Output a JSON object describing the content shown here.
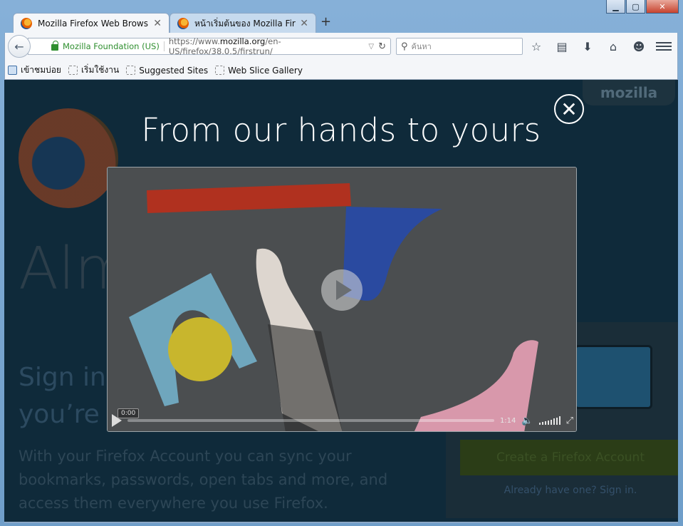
{
  "window": {
    "minimize": "▁",
    "maximize": "▢",
    "close": "✕"
  },
  "tabs": [
    {
      "label": "Mozilla Firefox Web Brows...",
      "close": "✕"
    },
    {
      "label": "หน้าเริ่มต้นของ Mozilla Firefox",
      "close": "✕"
    }
  ],
  "new_tab": "+",
  "navbar": {
    "back": "←",
    "identity": "Mozilla Foundation (US)",
    "url_prefix": "https://www.",
    "url_domain": "mozilla.org",
    "url_path": "/en-US/firefox/38.0.5/firstrun/",
    "search_placeholder": "ค้นหา"
  },
  "toolbar_icons": [
    "star-icon",
    "reading-list-icon",
    "download-icon",
    "home-icon",
    "hello-icon",
    "menu-icon"
  ],
  "bookmarks": [
    {
      "label": "เข้าชมบ่อย",
      "icon": "most-visited-icon"
    },
    {
      "label": "เริ่มใช้งาน",
      "icon": "bookmark-icon"
    },
    {
      "label": "Suggested Sites",
      "icon": "bookmark-icon"
    },
    {
      "label": "Web Slice Gallery",
      "icon": "bookmark-icon"
    }
  ],
  "page": {
    "brand": "mozilla",
    "heading_fragment": "Alm",
    "sub_line1": "Sign in t",
    "sub_line2": "you’re g",
    "body_text": "With your Firefox Account you can sync your bookmarks, passwords, open tabs and more, and access them everywhere you use Firefox.",
    "create_button": "Create a Firefox Account",
    "signin_link": "Already have one? Sign in."
  },
  "overlay": {
    "title": "From our hands to yours",
    "close": "✕"
  },
  "video": {
    "current_time": "0:00",
    "total_time": "1:14",
    "progress": 0
  },
  "colors": {
    "page_bg": "#0f2a3a",
    "identity_green": "#2f8f2f",
    "video_red": "#b0311f",
    "video_blue": "#2a4aa0",
    "video_teal": "#6fa6bd",
    "video_yellow": "#c8b62d",
    "video_pink": "#d898ab"
  }
}
